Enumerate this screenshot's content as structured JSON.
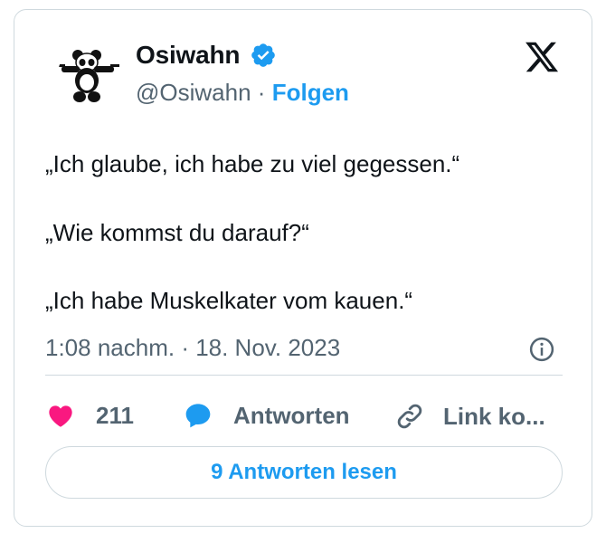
{
  "tweet": {
    "author_name": "Osiwahn",
    "author_handle": "@Osiwahn",
    "separator": "·",
    "follow_label": "Folgen",
    "lines": [
      "„Ich glaube, ich habe zu viel gegessen.“",
      "„Wie kommst du darauf?“",
      "„Ich habe Muskelkater vom kauen.“"
    ],
    "timestamp": "1:08 nachm. · 18. Nov. 2023"
  },
  "actions": {
    "like_count": "211",
    "reply_label": "Antworten",
    "link_label": "Link ko..."
  },
  "read_replies_label": "9 Antworten lesen",
  "icons": {
    "avatar": "panda-avatar",
    "verified": "verified-badge-icon",
    "platform": "x-logo-icon",
    "info": "info-icon",
    "like": "heart-icon",
    "reply": "speech-bubble-icon",
    "link": "link-icon"
  },
  "colors": {
    "accent": "#1d9bf0",
    "heart": "#f91880",
    "muted_text": "#536471",
    "border": "#cfd9de"
  }
}
